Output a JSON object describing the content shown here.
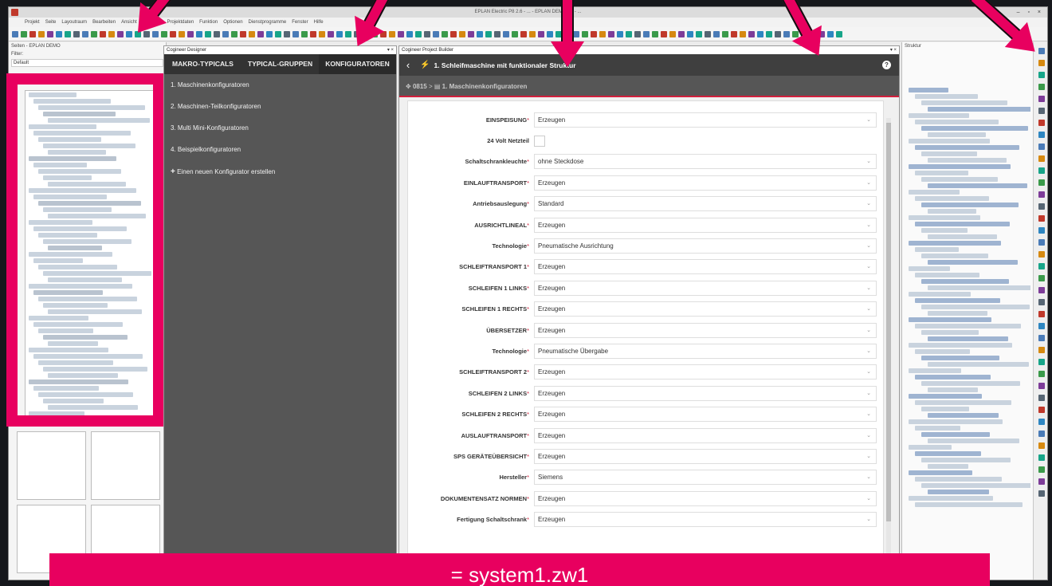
{
  "app": {
    "title": "EPLAN Electric P8 2.6 - ... - EPLAN DEMO - 1 - ...",
    "menu": [
      "Projekt",
      "Seite",
      "Layoutraum",
      "Bearbeiten",
      "Ansicht",
      "Einfügen",
      "Projektdaten",
      "Funktion",
      "Optionen",
      "Dienstprogramme",
      "Fenster",
      "Hilfe"
    ]
  },
  "left_panel": {
    "header": "Seiten - EPLAN DEMO",
    "filter_label": "Filter:",
    "filter_value": "Default"
  },
  "designer": {
    "pane_title": "Cogineer Designer",
    "pin_label": "▾ ×",
    "tabs": [
      "MAKRO-TYPICALS",
      "TYPICAL-GRUPPEN",
      "KONFIGURATOREN"
    ],
    "items": [
      "1. Maschinenkonfiguratoren",
      "2. Maschinen-Teilkonfiguratoren",
      "3. Multi Mini-Konfiguratoren",
      "4. Beispielkonfiguratoren"
    ],
    "add_label": "Einen neuen Konfigurator erstellen"
  },
  "builder": {
    "pane_title": "Cogineer Project Builder",
    "pin_label": "▾ ×",
    "title": "1. Schleifmaschine mit funktionaler Struktur",
    "breadcrumb_project": "0815",
    "breadcrumb_sep": ">",
    "breadcrumb_folder": "1. Maschinenkonfiguratoren",
    "help_label": "?",
    "fields": [
      {
        "label": "EINSPEISUNG",
        "required": "*",
        "value": "Erzeugen",
        "type": "select"
      },
      {
        "label": "24 Volt Netzteil",
        "required": "",
        "value": "",
        "type": "checkbox"
      },
      {
        "label": "Schaltschrankleuchte",
        "required": "*",
        "value": "ohne Steckdose",
        "type": "select"
      },
      {
        "label": "EINLAUFTRANSPORT",
        "required": "*",
        "value": "Erzeugen",
        "type": "select"
      },
      {
        "label": "Antriebsauslegung",
        "required": "*",
        "value": "Standard",
        "type": "select"
      },
      {
        "label": "AUSRICHTLINEAL",
        "required": "*",
        "value": "Erzeugen",
        "type": "select"
      },
      {
        "label": "Technologie",
        "required": "*",
        "value": "Pneumatische Ausrichtung",
        "type": "select"
      },
      {
        "label": "SCHLEIFTRANSPORT 1",
        "required": "*",
        "value": "Erzeugen",
        "type": "select"
      },
      {
        "label": "SCHLEIFEN 1 LINKS",
        "required": "*",
        "value": "Erzeugen",
        "type": "select"
      },
      {
        "label": "SCHLEIFEN 1 RECHTS",
        "required": "*",
        "value": "Erzeugen",
        "type": "select"
      },
      {
        "label": "ÜBERSETZER",
        "required": "*",
        "value": "Erzeugen",
        "type": "select"
      },
      {
        "label": "Technologie",
        "required": "*",
        "value": "Pneumatische Übergabe",
        "type": "select"
      },
      {
        "label": "SCHLEIFTRANSPORT 2",
        "required": "*",
        "value": "Erzeugen",
        "type": "select"
      },
      {
        "label": "SCHLEIFEN 2 LINKS",
        "required": "*",
        "value": "Erzeugen",
        "type": "select"
      },
      {
        "label": "SCHLEIFEN 2 RECHTS",
        "required": "*",
        "value": "Erzeugen",
        "type": "select"
      },
      {
        "label": "AUSLAUFTRANSPORT",
        "required": "*",
        "value": "Erzeugen",
        "type": "select"
      },
      {
        "label": "SPS GERÄTEÜBERSICHT",
        "required": "*",
        "value": "Erzeugen",
        "type": "select"
      },
      {
        "label": "Hersteller",
        "required": "*",
        "value": "Siemens",
        "type": "select"
      },
      {
        "label": "DOKUMENTENSATZ NORMEN",
        "required": "*",
        "value": "Erzeugen",
        "type": "select"
      },
      {
        "label": "Fertigung Schaltschrank",
        "required": "*",
        "value": "Erzeugen",
        "type": "select"
      }
    ]
  },
  "right_panel": {
    "header": "Struktur"
  },
  "banner": {
    "text": "= system1.zw1"
  },
  "colors": {
    "accent": "#e8005f",
    "header_dark": "#3f3f3f",
    "designer_bg": "#565656",
    "required_red": "#d21f3c"
  }
}
